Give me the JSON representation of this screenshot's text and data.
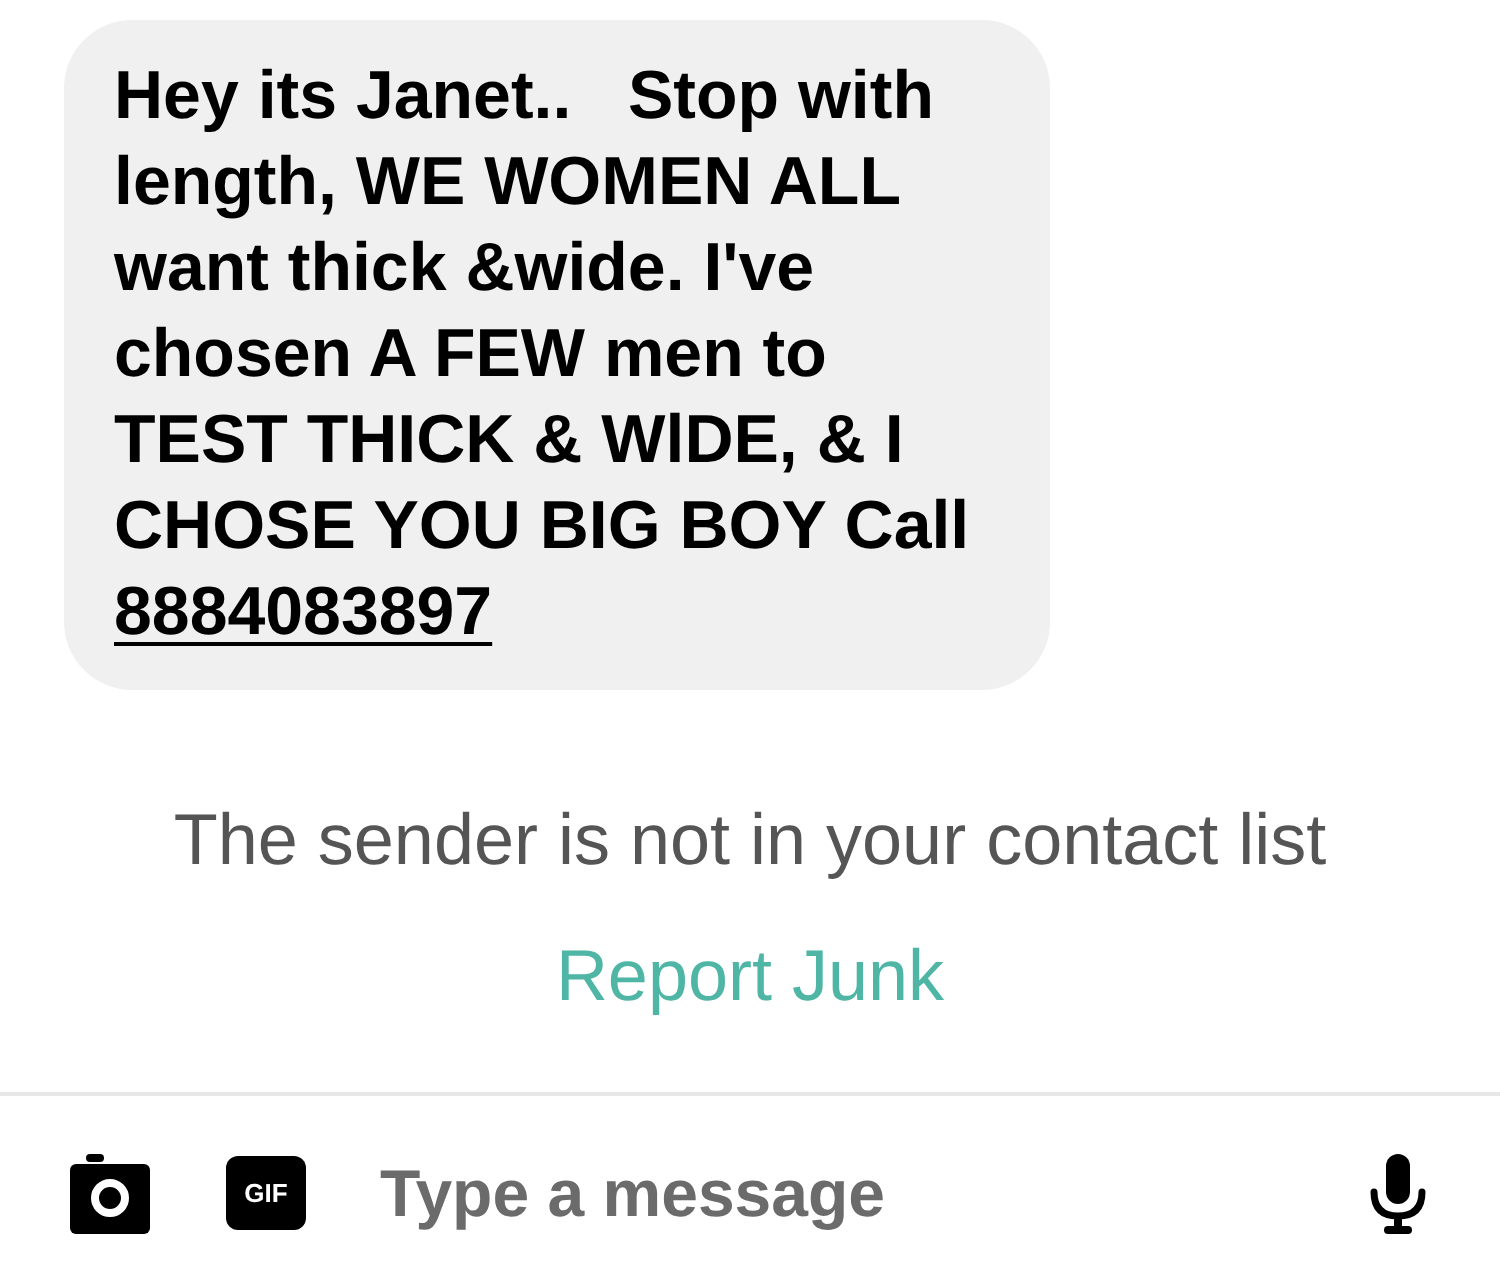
{
  "message": {
    "text": "Hey its Janet..   Stop with length, WE WOMEN ALL want thick &wide. I've chosen A FEW men to TEST THICK & WlDE, & I CHOSE YOU BIG BOY Call",
    "link": "8884083897"
  },
  "notice": {
    "text": "The sender is not in your contact list",
    "action": "Report Junk"
  },
  "composer": {
    "gif_label": "GIF",
    "placeholder": "Type a message"
  }
}
